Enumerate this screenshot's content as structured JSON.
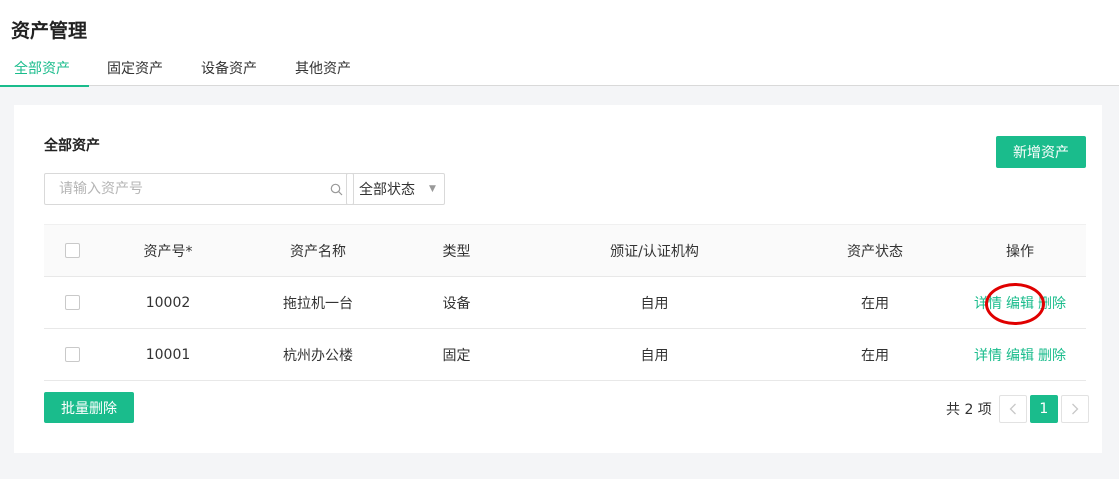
{
  "page": {
    "title": "资产管理"
  },
  "tabs": [
    {
      "label": "全部资产",
      "active": true
    },
    {
      "label": "固定资产",
      "active": false
    },
    {
      "label": "设备资产",
      "active": false
    },
    {
      "label": "其他资产",
      "active": false
    }
  ],
  "card": {
    "title": "全部资产",
    "add_label": "新增资产"
  },
  "search": {
    "placeholder": "请输入资产号",
    "value": ""
  },
  "status_filter": {
    "selected": "全部状态"
  },
  "table": {
    "columns": [
      "资产号*",
      "资产名称",
      "类型",
      "颁证/认证机构",
      "资产状态",
      "操作"
    ],
    "rows": [
      {
        "id": "10002",
        "name": "拖拉机一台",
        "type": "设备",
        "org": "自用",
        "status": "在用",
        "actions": [
          "详情",
          "编辑",
          "删除"
        ]
      },
      {
        "id": "10001",
        "name": "杭州办公楼",
        "type": "固定",
        "org": "自用",
        "status": "在用",
        "actions": [
          "详情",
          "编辑",
          "删除"
        ]
      }
    ]
  },
  "bulk_delete_label": "批量删除",
  "pagination": {
    "total": "共 2 项",
    "current_page": "1"
  },
  "colors": {
    "accent": "#1abc8c",
    "annotation": "#e00000"
  }
}
